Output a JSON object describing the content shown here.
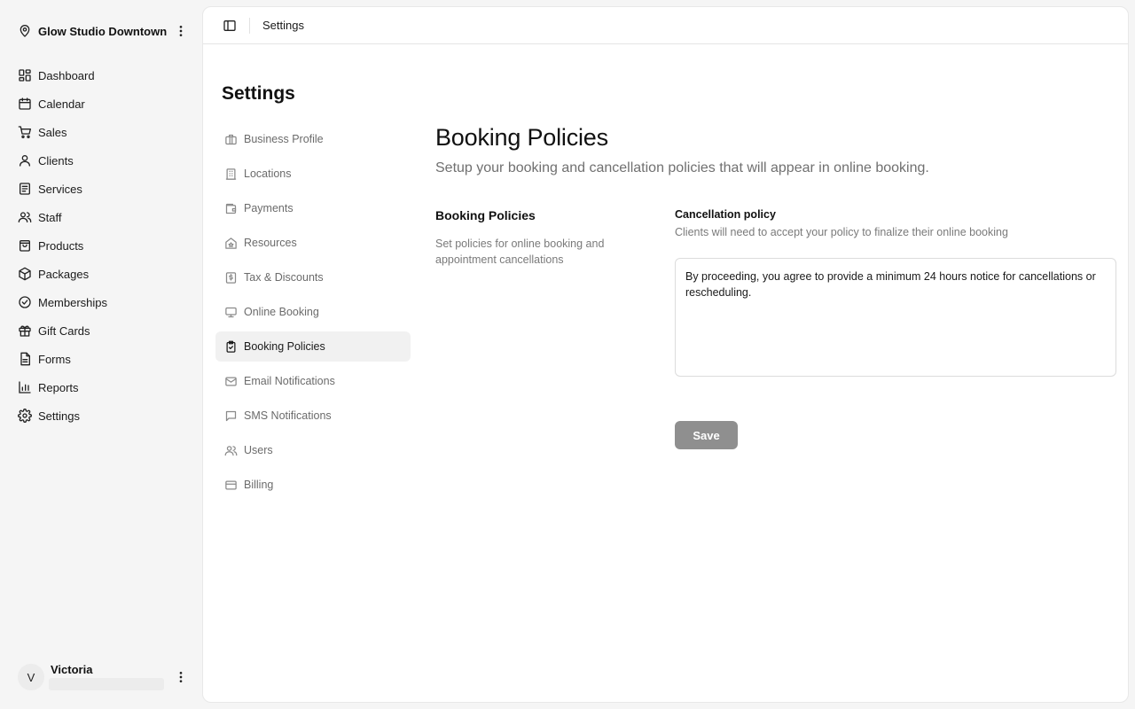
{
  "app": {
    "location_name": "Glow Studio Downtown"
  },
  "nav": [
    {
      "label": "Dashboard",
      "icon": "dashboard-icon"
    },
    {
      "label": "Calendar",
      "icon": "calendar-icon"
    },
    {
      "label": "Sales",
      "icon": "cart-icon"
    },
    {
      "label": "Clients",
      "icon": "user-icon"
    },
    {
      "label": "Services",
      "icon": "list-icon"
    },
    {
      "label": "Staff",
      "icon": "users-icon"
    },
    {
      "label": "Products",
      "icon": "bag-icon"
    },
    {
      "label": "Packages",
      "icon": "package-icon"
    },
    {
      "label": "Memberships",
      "icon": "badge-check-icon"
    },
    {
      "label": "Gift Cards",
      "icon": "gift-icon"
    },
    {
      "label": "Forms",
      "icon": "form-icon"
    },
    {
      "label": "Reports",
      "icon": "chart-icon"
    },
    {
      "label": "Settings",
      "icon": "gear-icon"
    }
  ],
  "user": {
    "initial": "V",
    "name": "Victoria"
  },
  "topbar": {
    "breadcrumb": "Settings"
  },
  "settings": {
    "title": "Settings",
    "active_item": "Booking Policies",
    "items": [
      {
        "label": "Business Profile",
        "icon": "briefcase-icon"
      },
      {
        "label": "Locations",
        "icon": "building-icon"
      },
      {
        "label": "Payments",
        "icon": "wallet-icon"
      },
      {
        "label": "Resources",
        "icon": "home-icon"
      },
      {
        "label": "Tax & Discounts",
        "icon": "receipt-icon"
      },
      {
        "label": "Online Booking",
        "icon": "monitor-icon"
      },
      {
        "label": "Booking Policies",
        "icon": "clipboard-check-icon"
      },
      {
        "label": "Email Notifications",
        "icon": "mail-icon"
      },
      {
        "label": "SMS Notifications",
        "icon": "message-icon"
      },
      {
        "label": "Users",
        "icon": "users-icon"
      },
      {
        "label": "Billing",
        "icon": "credit-card-icon"
      }
    ]
  },
  "page": {
    "heading": "Booking Policies",
    "subheading": "Setup your booking and cancellation policies that will appear in online booking.",
    "section": {
      "title": "Booking Policies",
      "description": "Set policies for online booking and appointment cancellations"
    },
    "cancellation": {
      "label": "Cancellation policy",
      "help": "Clients will need to accept your policy to finalize their online booking",
      "value": "By proceeding, you agree to provide a minimum 24 hours notice for cancellations or rescheduling."
    },
    "save_label": "Save"
  },
  "colors": {
    "save_button": "#8f8f8f",
    "active_item_bg": "#f1f1f1",
    "page_bg": "#f5f5f5"
  }
}
